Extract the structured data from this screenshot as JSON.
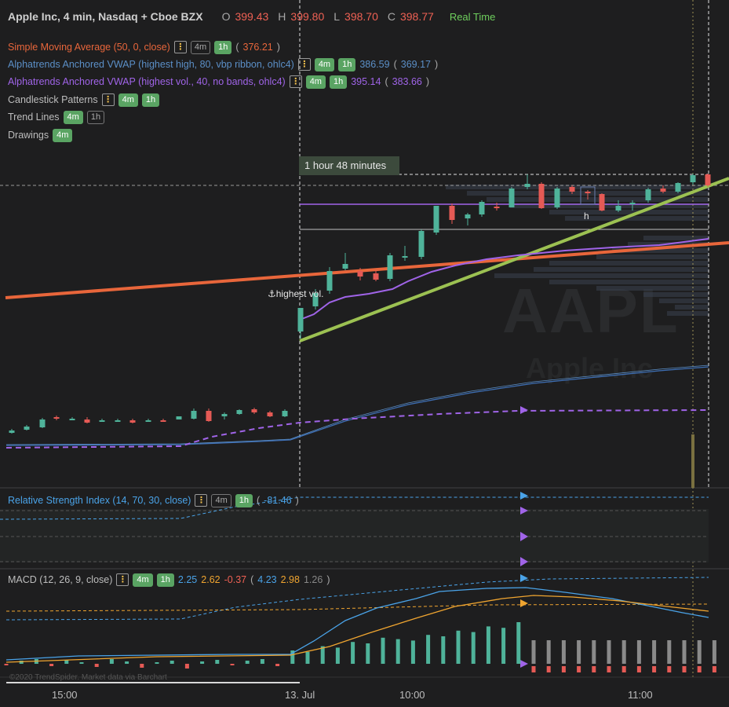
{
  "header": {
    "symbol": "Apple Inc, 4 min, Nasdaq + Cboe BZX",
    "o_label": "O",
    "o": "399.43",
    "h_label": "H",
    "h": "399.80",
    "l_label": "L",
    "l": "398.70",
    "c_label": "C",
    "c": "398.77",
    "realtime": "Real Time"
  },
  "legend": {
    "sma": {
      "label": "Simple Moving Average (50, 0, close)",
      "tf1": "4m",
      "tf2": "1h",
      "value": "376.21",
      "color": "#e8663b"
    },
    "vwap1": {
      "label": "Alphatrends Anchored VWAP (highest high, 80, vbp ribbon, ohlc4)",
      "tf1": "4m",
      "tf2": "1h",
      "v1": "386.59",
      "v2": "369.17",
      "color": "#5b8fc7"
    },
    "vwap2": {
      "label": "Alphatrends Anchored VWAP (highest vol., 40, no bands, ohlc4)",
      "tf1": "4m",
      "tf2": "1h",
      "v1": "395.14",
      "v2": "383.66",
      "color": "#a064e8"
    },
    "candle": {
      "label": "Candlestick Patterns",
      "tf1": "4m",
      "tf2": "1h"
    },
    "trend": {
      "label": "Trend Lines",
      "tf1": "4m",
      "tf2": "1h"
    },
    "drawings": {
      "label": "Drawings",
      "tf1": "4m"
    }
  },
  "duration_label": "1 hour 48 minutes",
  "anchor_label": "⚓highest vol.",
  "pattern_label": "h",
  "watermark": {
    "line1": "AAPL",
    "line2": "Apple Inc"
  },
  "rsi": {
    "label": "Relative Strength Index (14, 70, 30, close)",
    "tf1": "4m",
    "tf2": "1h",
    "value": "-81.46",
    "color": "#4aa3e8"
  },
  "macd": {
    "label": "MACD (12, 26, 9, close)",
    "tf1": "4m",
    "tf2": "1h",
    "v1": "2.25",
    "v2": "2.62",
    "v3": "-0.37",
    "v4": "4.23",
    "v5": "2.98",
    "v6": "1.26"
  },
  "copyright": "©2020 TrendSpider. Market data via Barchart",
  "xaxis": {
    "labels": [
      "15:00",
      "13. Jul",
      "10:00",
      "11:00"
    ]
  },
  "icons": {
    "menu": "kebab-menu-icon",
    "anchor": "anchor-icon"
  }
}
